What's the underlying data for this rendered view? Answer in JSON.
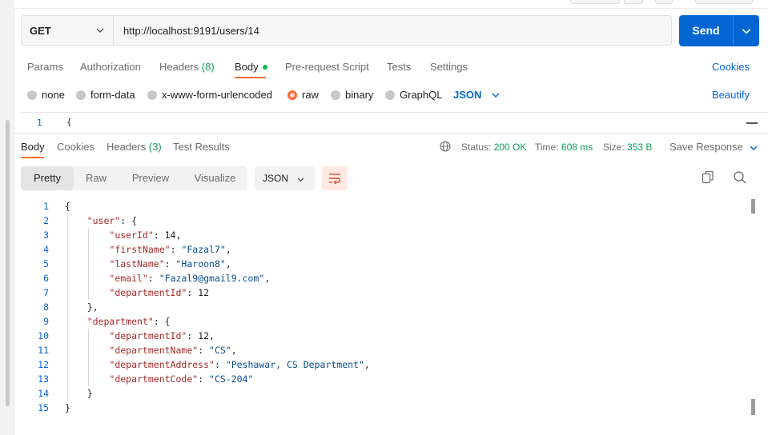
{
  "request": {
    "method": "GET",
    "url": "http://localhost:9191/users/14",
    "send_label": "Send"
  },
  "request_tabs": [
    {
      "label": "Params"
    },
    {
      "label": "Authorization"
    },
    {
      "label": "Headers",
      "count": "(8)"
    },
    {
      "label": "Body",
      "active": true
    },
    {
      "label": "Pre-request Script"
    },
    {
      "label": "Tests"
    },
    {
      "label": "Settings"
    }
  ],
  "cookies_link": "Cookies",
  "body_types": [
    {
      "label": "none"
    },
    {
      "label": "form-data"
    },
    {
      "label": "x-www-form-urlencoded"
    },
    {
      "label": "raw",
      "selected": true
    },
    {
      "label": "binary"
    },
    {
      "label": "GraphQL"
    }
  ],
  "raw_format": "JSON",
  "beautify_label": "Beautify",
  "request_editor": {
    "line": "1",
    "content": "{"
  },
  "response_tabs": [
    {
      "label": "Body",
      "active": true
    },
    {
      "label": "Cookies"
    },
    {
      "label": "Headers",
      "count": "(3)"
    },
    {
      "label": "Test Results"
    }
  ],
  "response_meta": {
    "status_label": "Status:",
    "status_value": "200 OK",
    "time_label": "Time:",
    "time_value": "608 ms",
    "size_label": "Size:",
    "size_value": "353 B",
    "save_label": "Save Response"
  },
  "view_modes": [
    {
      "label": "Pretty",
      "active": true
    },
    {
      "label": "Raw"
    },
    {
      "label": "Preview"
    },
    {
      "label": "Visualize"
    }
  ],
  "response_format": "JSON",
  "response_lines": [
    "{",
    "    \"user\": {",
    "        \"userId\": 14,",
    "        \"firstName\": \"Fazal7\",",
    "        \"lastName\": \"Haroon8\",",
    "        \"email\": \"Fazal9@gmail9.com\",",
    "        \"departmentId\": 12",
    "    },",
    "    \"department\": {",
    "        \"departmentId\": 12,",
    "        \"departmentName\": \"CS\",",
    "        \"departmentAddress\": \"Peshawar, CS Department\",",
    "        \"departmentCode\": \"CS-204\"",
    "    }",
    "}"
  ],
  "colors": {
    "accent": "#ff6c37",
    "primary": "#0265d2",
    "success": "#0f9d58"
  }
}
